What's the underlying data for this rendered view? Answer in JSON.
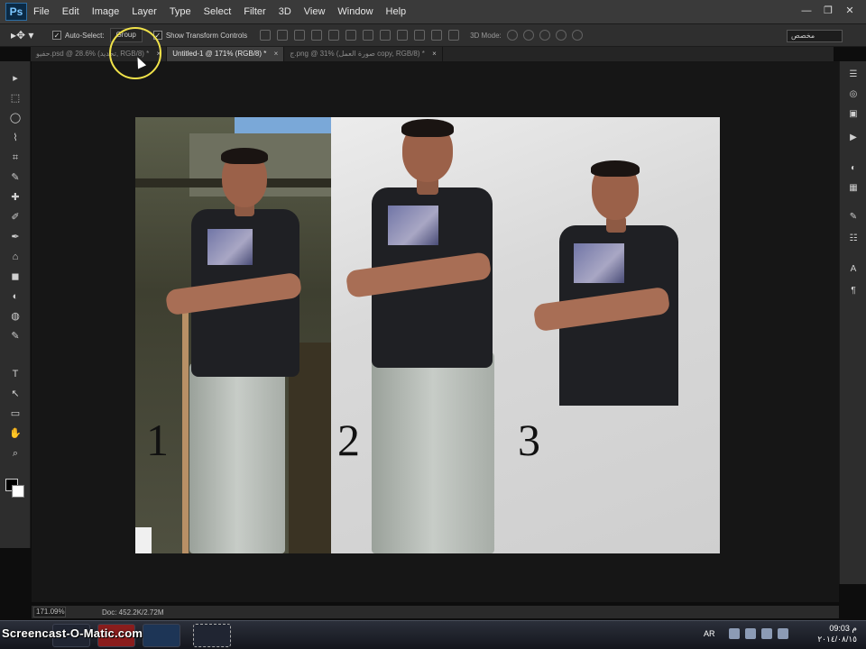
{
  "app": {
    "logo": "Ps"
  },
  "menu": [
    "File",
    "Edit",
    "Image",
    "Layer",
    "Type",
    "Select",
    "Filter",
    "3D",
    "View",
    "Window",
    "Help"
  ],
  "window_controls": [
    "—",
    "❐",
    "✕"
  ],
  "options": {
    "tool_icon": "move-tool-icon",
    "auto_select_label": "Auto-Select:",
    "auto_select_value": "Group",
    "show_transform_label": "Show Transform Controls",
    "mode3d_label": "3D Mode:",
    "workspace_value": "مخصص"
  },
  "tabs": [
    {
      "label": "حفيو.psd @ 28.6% (تحديد, RGB/8) *",
      "active": false
    },
    {
      "label": "Untitled-1 @ 171% (RGB/8) *",
      "active": true
    },
    {
      "label": "ج.png @ 31% (صورة العمل copy, RGB/8) *",
      "active": false
    }
  ],
  "tools": [
    "▸",
    "⬚",
    "◯",
    "⌇",
    "⌗",
    "✎",
    "✚",
    "✐",
    "✒",
    "⌂",
    "◼",
    "◐",
    "◍",
    "✎",
    "T",
    "↖",
    "▭",
    "✋",
    "⌕"
  ],
  "right_panel_icons": [
    "layers-icon",
    "channels-icon",
    "history-icon",
    "actions-icon",
    "color-icon",
    "swatches-icon",
    "brush-icon",
    "adjust-icon",
    "character-icon",
    "paragraph-icon"
  ],
  "canvas": {
    "labels": [
      "1",
      "2",
      "3"
    ]
  },
  "status": {
    "zoom": "171.09%",
    "doc_info": "Doc: 452.2K/2.72M"
  },
  "taskbar": {
    "watermark": "Screencast-O-Matic.com",
    "lang": "AR",
    "time": "09:03 م",
    "date": "٢٠١٤/٠٨/١٥"
  },
  "colors": {
    "accent": "#f0e24a",
    "menubar": "#3a3a3a",
    "workspace": "#161616"
  }
}
